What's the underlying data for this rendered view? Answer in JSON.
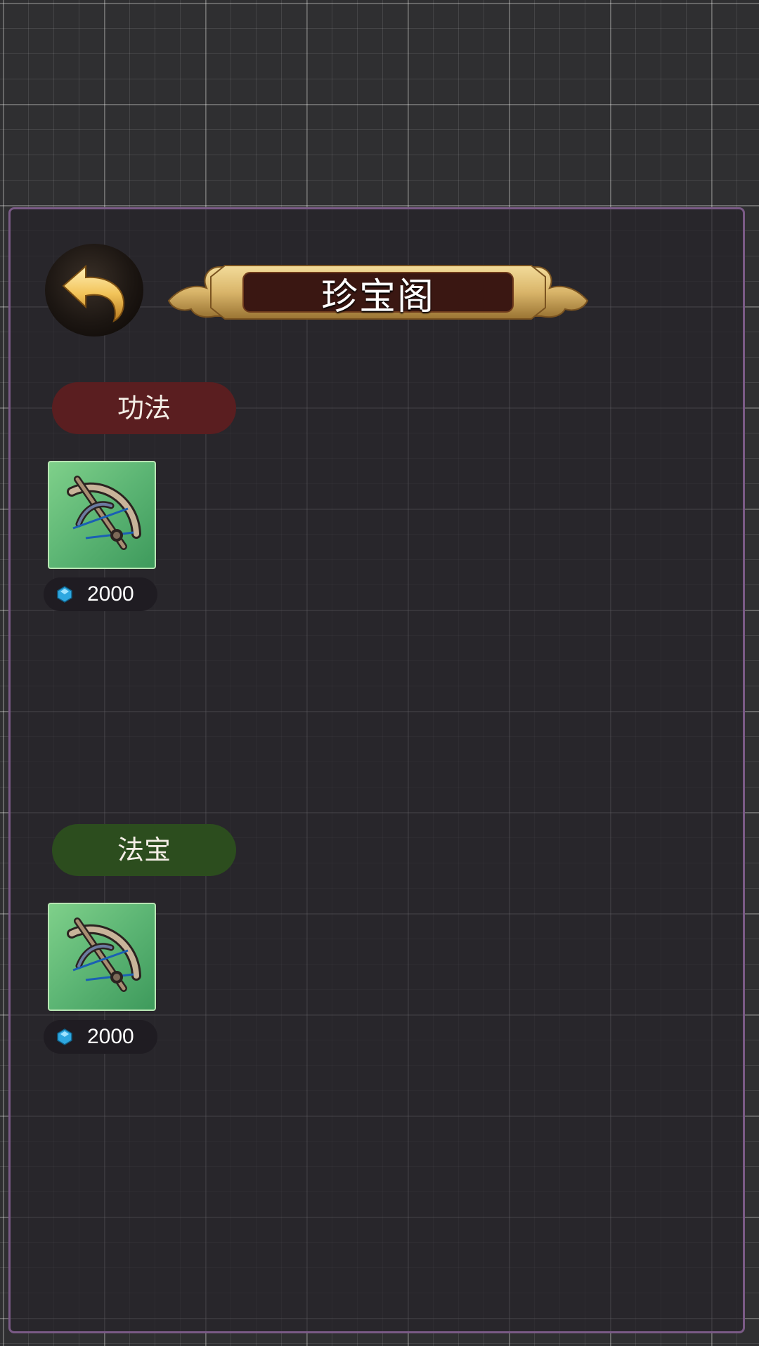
{
  "header": {
    "title": "珍宝阁",
    "back_icon": "back-arrow-icon"
  },
  "sections": [
    {
      "label": "功法",
      "color": "#5a1e20",
      "items": [
        {
          "icon": "crossbow-icon",
          "price": "2000",
          "currency_icon": "blue-gem-icon"
        }
      ]
    },
    {
      "label": "法宝",
      "color": "#2c4d1e",
      "items": [
        {
          "icon": "crossbow-icon",
          "price": "2000",
          "currency_icon": "blue-gem-icon"
        }
      ]
    }
  ],
  "colors": {
    "panel_border": "#7a5a86",
    "banner_gold": "#d9b56a",
    "banner_fill": "#3a1712",
    "card_green": "#5cb574",
    "gem_blue": "#2ea7e0"
  }
}
